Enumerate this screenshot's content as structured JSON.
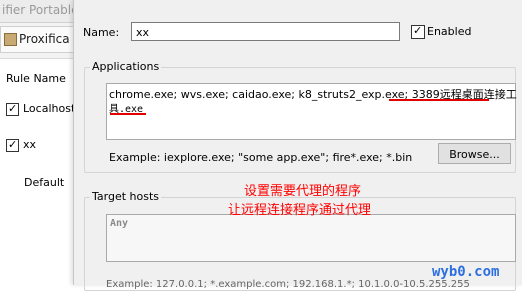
{
  "background_window": {
    "title_fragment": "ifier Portable",
    "tab_label": "Proxifica",
    "rule_column_header": "Rule Name",
    "rules": [
      {
        "label": "Localhost",
        "checked": true
      },
      {
        "label": "xx",
        "checked": true
      },
      {
        "label": "Default",
        "checked": null
      }
    ]
  },
  "dialog": {
    "name_label": "Name:",
    "name_value": "xx",
    "enabled_label": "Enabled",
    "enabled_checked": true,
    "applications": {
      "legend": "Applications",
      "value_line1": "chrome.exe; wvs.exe;  caidao.exe; k8_struts2_exp.exe; 3389远程桌面连接工",
      "value_line2": "具.exe",
      "example": "Example: iexplore.exe; \"some app.exe\"; fire*.exe; *.bin",
      "browse_label": "Browse..."
    },
    "target_hosts": {
      "legend": "Target hosts",
      "value": "Any",
      "example": "Example: 127.0.0.1; *.example.com; 192.168.1.*; 10.1.0.0-10.5.255.255"
    }
  },
  "annotations": {
    "line1": "设置需要代理的程序",
    "line2": "让远程连接程序通过代理",
    "color": "#ff0000"
  },
  "watermark": "wyb0.com"
}
